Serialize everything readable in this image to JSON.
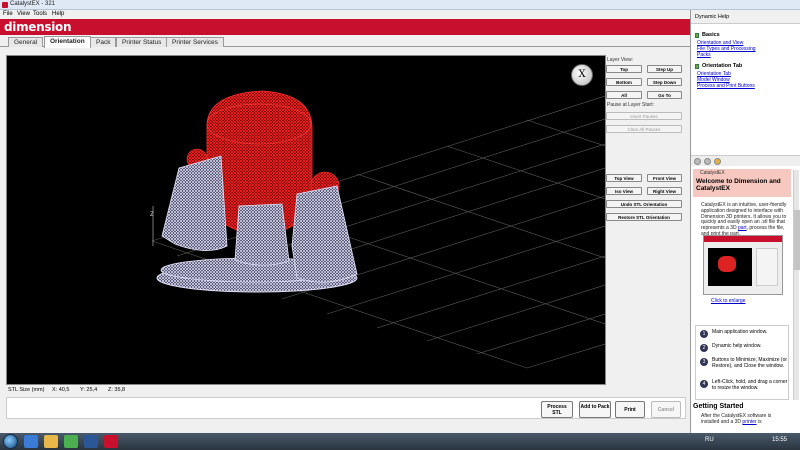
{
  "window": {
    "title": "CatalystEX - 321"
  },
  "menu": [
    "File",
    "View",
    "Tools",
    "Help"
  ],
  "brand": {
    "logo": "dimension"
  },
  "tabs": [
    {
      "label": "General",
      "active": false
    },
    {
      "label": "Orientation",
      "active": true
    },
    {
      "label": "Pack",
      "active": false
    },
    {
      "label": "Printer Status",
      "active": false
    },
    {
      "label": "Printer Services",
      "active": false
    }
  ],
  "stl": {
    "size_label": "STL Size (mm)",
    "x": "X:  40,5",
    "y": "Y:  25,4",
    "z": "Z:  35,8"
  },
  "viewport": {
    "axis_label": "Z"
  },
  "layer_panel": {
    "layer_view_label": "Layer View:",
    "top": "Top",
    "step_up": "Step Up",
    "bottom": "Bottom",
    "step_down": "Step Down",
    "all": "All",
    "go_to": "Go To",
    "pause_label": "Pause at Layer Start:",
    "insert_pauses": "Insert Pauses",
    "clear_all_pauses": "Clear All Pauses",
    "top_view": "Top View",
    "front_view": "Front View",
    "iso_view": "Iso View",
    "right_view": "Right View",
    "undo_stl": "Undo STL Orientation",
    "restore_stl": "Restore STL Orientation"
  },
  "bottom_buttons": {
    "process": "Process STL",
    "add_to_pack": "Add to Pack",
    "print": "Print",
    "cancel": "Cancel"
  },
  "help": {
    "header": "Dynamic Help",
    "basics_title": "Basics",
    "basics_links": [
      "Orientation and View",
      "File Types and Processing",
      "Packs"
    ],
    "orientation_title": "Orientation Tab",
    "orientation_links": [
      "Orientation Tab",
      "Model Window",
      "Process and Print Buttons"
    ],
    "page_label": "CatalystEX",
    "welcome_title": "Welcome to Dimension and CatalystEX",
    "intro_1": "CatalystEX is an intuitive, user-friendly application designed to interface with Dimension 3D printers. It allows you to quickly and easily open an .stl file that represents a 3D",
    "intro_link_part": "part",
    "intro_2": ", process the file, and print the part.",
    "enlarge": "Click to enlarge",
    "steps": [
      {
        "num": "1",
        "text": "Main application window."
      },
      {
        "num": "2",
        "text": "Dynamic help window."
      },
      {
        "num": "3",
        "text": "Buttons to Minimize, Maximize (or Restore), and Close the window."
      },
      {
        "num": "4",
        "text": "Left-Click, hold, and drag a corner to resize the window."
      }
    ],
    "getting_started": "Getting Started",
    "gs_text_1": "After the CatalystEX software is installed and a 3D",
    "gs_link": "printer",
    "gs_text_2": "is"
  },
  "taskbar": {
    "lang": "RU",
    "time": "15:55"
  },
  "colors": {
    "brand": "#c8102e",
    "model_top": "#ff1a1a",
    "model_base": "#d8d8f0"
  }
}
